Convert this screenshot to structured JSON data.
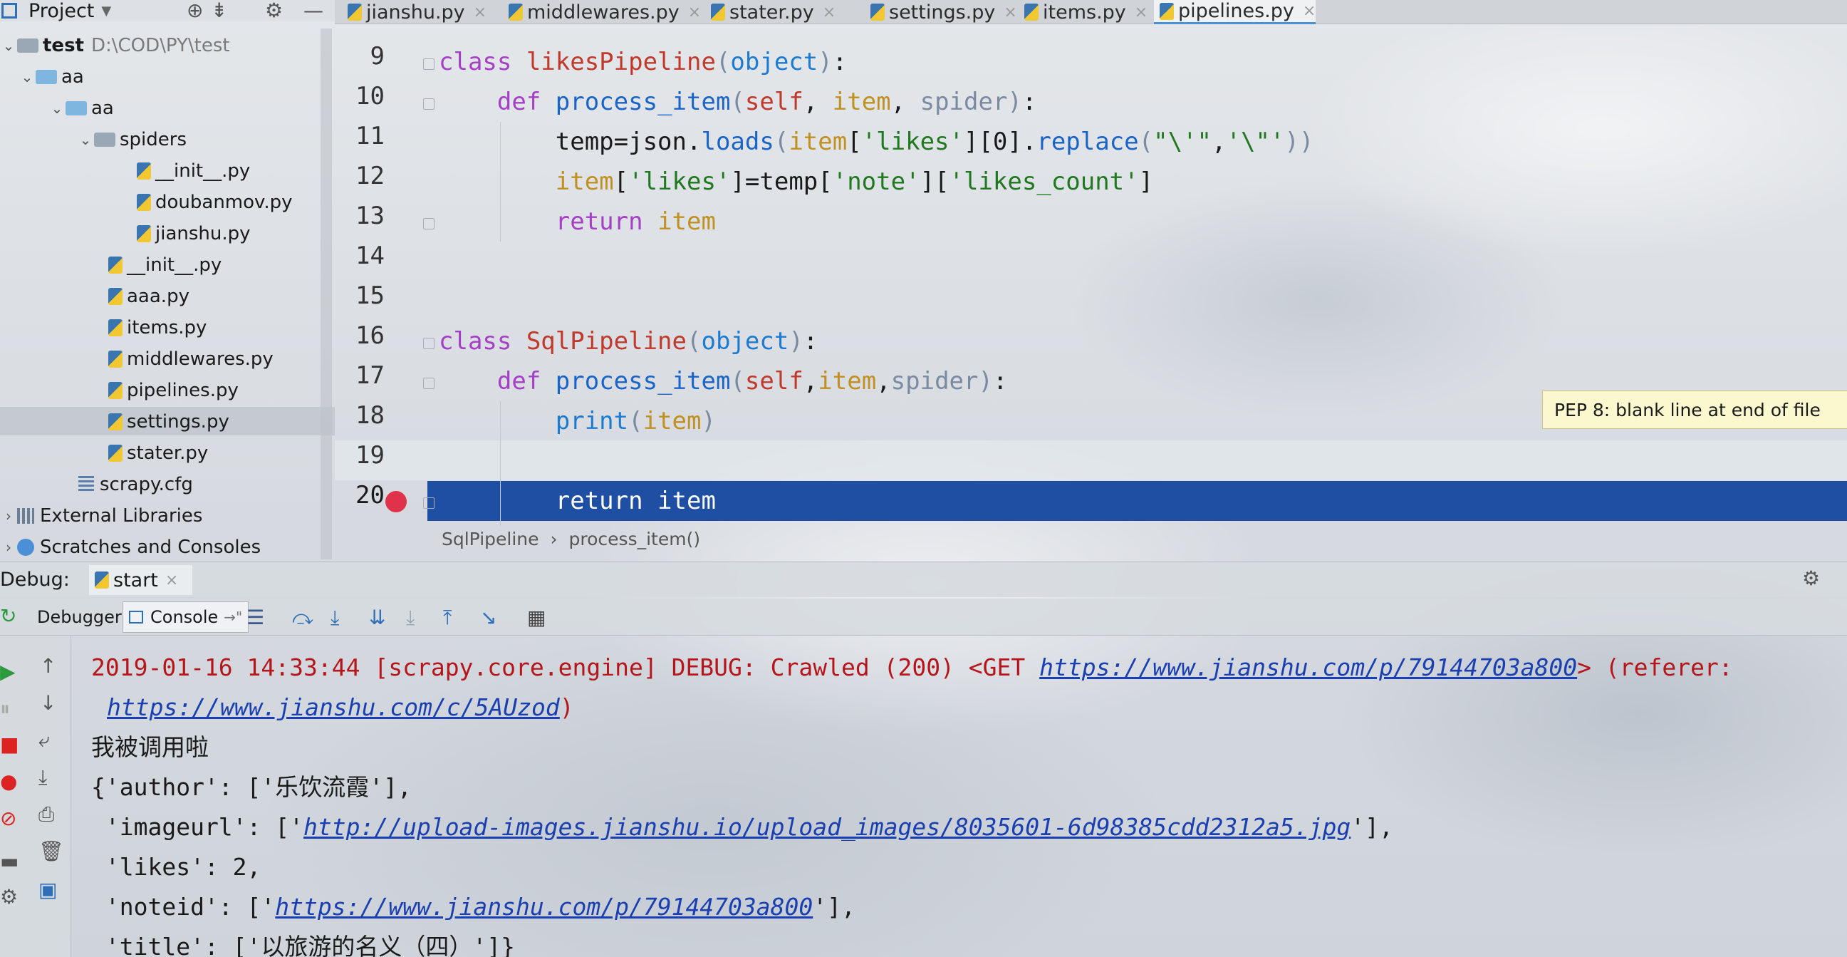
{
  "project_panel": {
    "title": "Project",
    "tree": [
      {
        "label": "test",
        "path": "D:\\COD\\PY\\test"
      },
      {
        "label": "aa"
      },
      {
        "label": "aa"
      },
      {
        "label": "spiders"
      },
      {
        "label": "__init__.py"
      },
      {
        "label": "doubanmov.py"
      },
      {
        "label": "jianshu.py"
      },
      {
        "label": "__init__.py"
      },
      {
        "label": "aaa.py"
      },
      {
        "label": "items.py"
      },
      {
        "label": "middlewares.py"
      },
      {
        "label": "pipelines.py"
      },
      {
        "label": "settings.py"
      },
      {
        "label": "stater.py"
      },
      {
        "label": "scrapy.cfg"
      },
      {
        "label": "External Libraries"
      },
      {
        "label": "Scratches and Consoles"
      }
    ]
  },
  "tabs": [
    "jianshu.py",
    "middlewares.py",
    "stater.py",
    "settings.py",
    "items.py",
    "pipelines.py"
  ],
  "editor": {
    "line_numbers": [
      "9",
      "10",
      "11",
      "12",
      "13",
      "14",
      "15",
      "16",
      "17",
      "18",
      "19",
      "20"
    ],
    "breadcrumb": [
      "SqlPipeline",
      "process_item()"
    ],
    "tooltip": "PEP 8: blank line at end of file"
  },
  "debug": {
    "label": "Debug:",
    "run_tab": "start",
    "tabs": [
      "Debugger",
      "Console"
    ],
    "console": {
      "line1_prefix": "2019-01-16 14:33:44 [scrapy.core.engine] DEBUG: Crawled (200) <GET ",
      "line1_link": "https://www.jianshu.com/p/79144703a800",
      "line1_suffix": "> (referer:",
      "line2_link": "https://www.jianshu.com/c/5AUzod",
      "line2_suffix": ")",
      "line3": "我被调用啦",
      "author_prefix": "{'author': ['",
      "author_value": "乐饮流霞",
      "author_suffix": "'],",
      "imageurl_prefix": " 'imageurl': ['",
      "imageurl_link": "http://upload-images.jianshu.io/upload_images/8035601-6d98385cdd2312a5.jpg",
      "imageurl_suffix": "'],",
      "likes_line": " 'likes': 2,",
      "noteid_prefix": " 'noteid': ['",
      "noteid_link": "https://www.jianshu.com/p/79144703a800",
      "noteid_suffix": "'],",
      "title_prefix": " 'title': ['",
      "title_value": "以旅游的名义（四）",
      "title_suffix": "']}"
    }
  },
  "colors": {
    "breakpoint": "#e0324a",
    "selection": "#1e4fa3",
    "keyword": "#a53fc6",
    "class_name": "#c0392b",
    "function": "#1a64c8"
  }
}
